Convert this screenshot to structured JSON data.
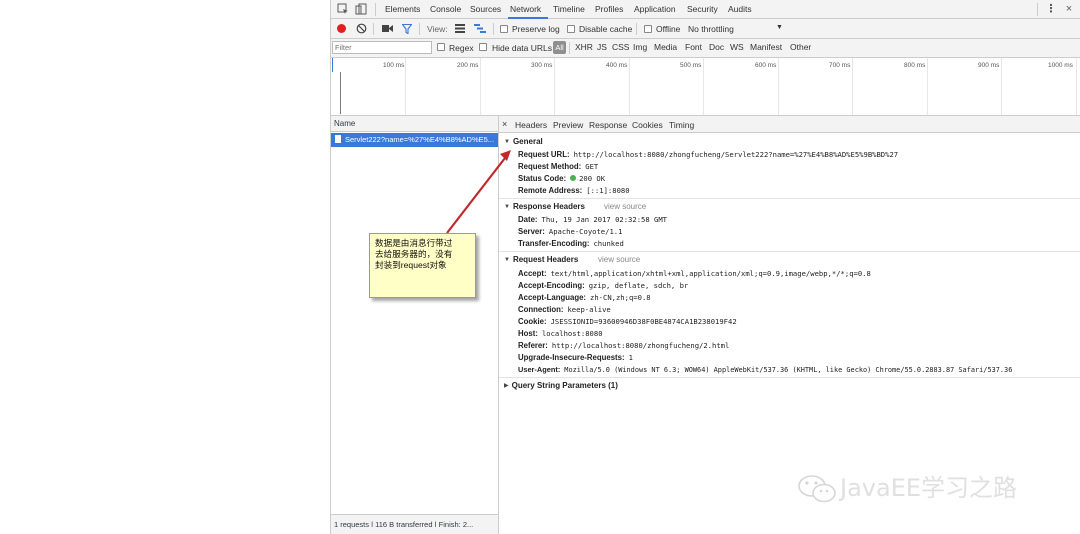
{
  "tabs": [
    {
      "label": "Elements",
      "active": false
    },
    {
      "label": "Console",
      "active": false
    },
    {
      "label": "Sources",
      "active": false
    },
    {
      "label": "Network",
      "active": true
    },
    {
      "label": "Timeline",
      "active": false
    },
    {
      "label": "Profiles",
      "active": false
    },
    {
      "label": "Application",
      "active": false
    },
    {
      "label": "Security",
      "active": false
    },
    {
      "label": "Audits",
      "active": false
    }
  ],
  "toolbar": {
    "view_label": "View:",
    "preserve_log": "Preserve log",
    "disable_cache": "Disable cache",
    "offline": "Offline",
    "throttling": "No throttling"
  },
  "filter": {
    "placeholder": "Filter",
    "regex": "Regex",
    "hide_data_urls": "Hide data URLs",
    "types": [
      "All",
      "XHR",
      "JS",
      "CSS",
      "Img",
      "Media",
      "Font",
      "Doc",
      "WS",
      "Manifest",
      "Other"
    ]
  },
  "timeline": {
    "ticks": [
      "100 ms",
      "200 ms",
      "300 ms",
      "400 ms",
      "500 ms",
      "600 ms",
      "700 ms",
      "800 ms",
      "900 ms",
      "1000 ms"
    ]
  },
  "request_list": {
    "header": "Name",
    "rows": [
      "Servlet222?name=%27%E4%B8%AD%E5..."
    ],
    "status": "1 requests  ǀ  116 B transferred  ǀ  Finish: 2..."
  },
  "detail": {
    "close": "×",
    "tabs": [
      "Headers",
      "Preview",
      "Response",
      "Cookies",
      "Timing"
    ],
    "general": {
      "title": "General",
      "rows": [
        {
          "key": "Request URL:",
          "value": "http://localhost:8080/zhongfucheng/Servlet222?name=%27%E4%B8%AD%E5%9B%BD%27"
        },
        {
          "key": "Request Method:",
          "value": "GET"
        },
        {
          "key": "Status Code:",
          "value": "200 OK"
        },
        {
          "key": "Remote Address:",
          "value": "[::1]:8080"
        }
      ]
    },
    "response_headers": {
      "title": "Response Headers",
      "view_source": "view source",
      "rows": [
        {
          "key": "Date:",
          "value": "Thu, 19 Jan 2017 02:32:58 GMT"
        },
        {
          "key": "Server:",
          "value": "Apache-Coyote/1.1"
        },
        {
          "key": "Transfer-Encoding:",
          "value": "chunked"
        }
      ]
    },
    "request_headers": {
      "title": "Request Headers",
      "view_source": "view source",
      "rows": [
        {
          "key": "Accept:",
          "value": "text/html,application/xhtml+xml,application/xml;q=0.9,image/webp,*/*;q=0.8"
        },
        {
          "key": "Accept-Encoding:",
          "value": "gzip, deflate, sdch, br"
        },
        {
          "key": "Accept-Language:",
          "value": "zh-CN,zh;q=0.8"
        },
        {
          "key": "Connection:",
          "value": "keep-alive"
        },
        {
          "key": "Cookie:",
          "value": "JSESSIONID=93600946D38F0BE4874CA1B238019F42"
        },
        {
          "key": "Host:",
          "value": "localhost:8080"
        },
        {
          "key": "Referer:",
          "value": "http://localhost:8080/zhongfucheng/2.html"
        },
        {
          "key": "Upgrade-Insecure-Requests:",
          "value": "1"
        },
        {
          "key": "User-Agent:",
          "value": "Mozilla/5.0 (Windows NT 6.3; WOW64) AppleWebKit/537.36 (KHTML, like Gecko) Chrome/55.0.2883.87 Safari/537.36"
        }
      ]
    },
    "query_params": {
      "title": "Query String Parameters (1)"
    }
  },
  "callout": {
    "lines": [
      "数据是由消息行带过",
      "去给服务器的，没有",
      "封装到request对象"
    ]
  },
  "watermark": {
    "text": "JavaEE学习之路"
  },
  "colors": {
    "accent": "#3879d9",
    "record": "#e02020",
    "status_ok": "#4caf50",
    "callout_bg": "#ffffc6",
    "arrow": "#c0282c"
  }
}
